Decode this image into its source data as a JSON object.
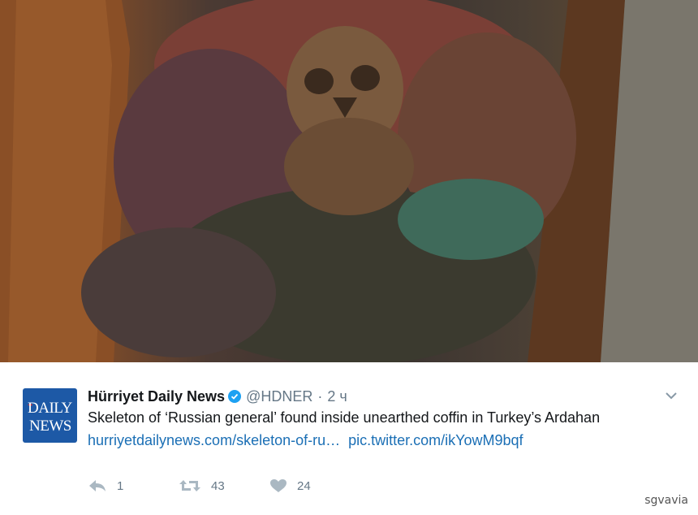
{
  "tweet": {
    "author_name": "Hürriyet Daily News",
    "handle": "@HDNER",
    "separator": "·",
    "timestamp": "2 ч",
    "text": "Skeleton of ‘Russian general’ found inside unearthed coffin in Turkey’s Ardahan",
    "link_url": "hurriyetdailynews.com/skeleton-of-ru…",
    "pic_link": "pic.twitter.com/ikYowM9bqf",
    "avatar": {
      "line1": "DAILY",
      "line2": "NEWS"
    },
    "actions": {
      "reply_count": "1",
      "retweet_count": "43",
      "like_count": "24"
    }
  },
  "watermark": "sgvavia",
  "colors": {
    "link": "#1b6fb5",
    "muted": "#657786",
    "verified": "#1da1f2",
    "avatar_bg": "#1d59a6"
  },
  "icons": {
    "verified": "verified-badge-icon",
    "caret": "chevron-down-icon",
    "reply": "reply-icon",
    "retweet": "retweet-icon",
    "like": "heart-icon"
  }
}
